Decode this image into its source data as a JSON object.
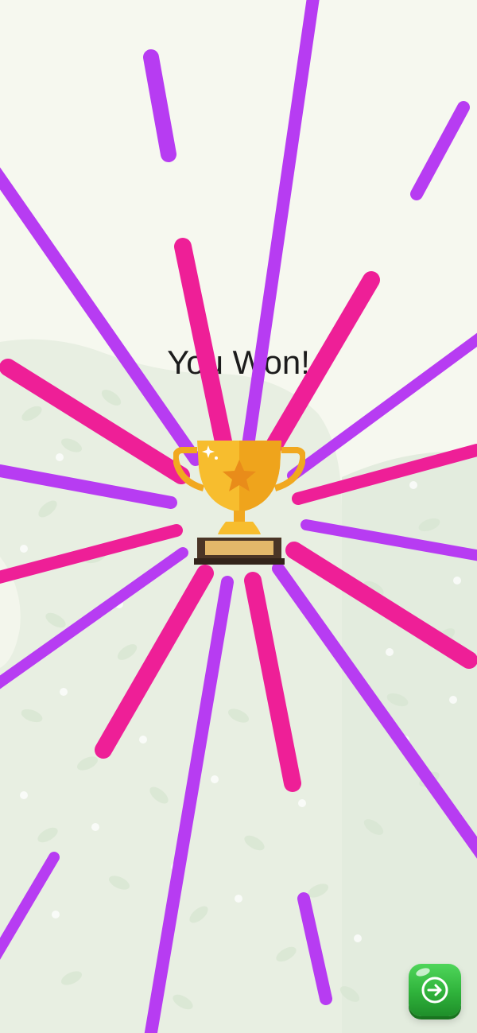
{
  "game": {
    "result_title": "You Won!"
  },
  "colors": {
    "background": "#f6f8ef",
    "foliage": "#e4ecdf",
    "ray_purple": "#b73cf2",
    "ray_pink": "#ee1f97",
    "trophy_gold": "#f4b62b",
    "button_green": "#2fb23b"
  },
  "icons": {
    "trophy": "trophy-icon",
    "next": "arrow-right-icon"
  }
}
